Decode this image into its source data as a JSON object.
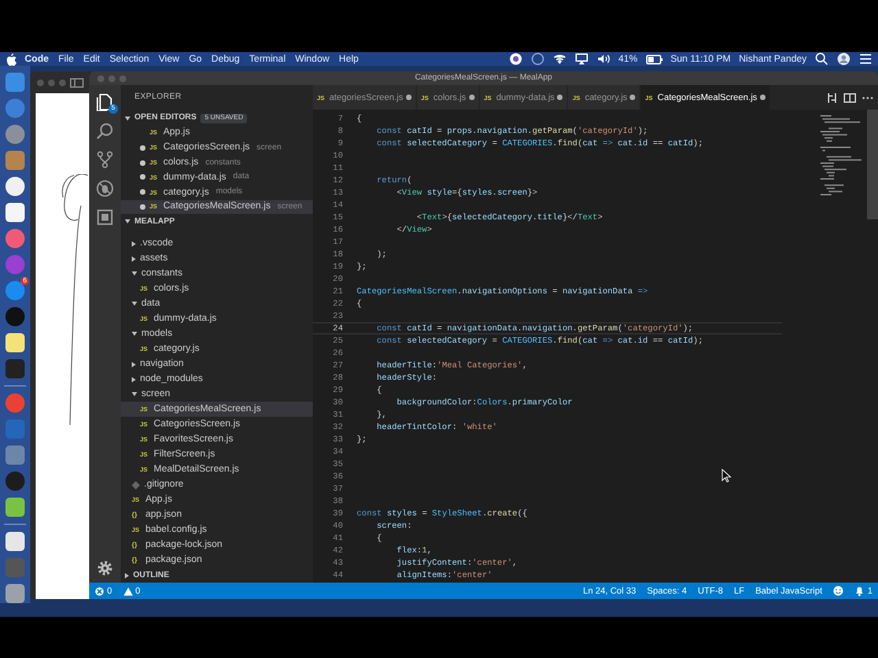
{
  "menu_bar": {
    "app": "Code",
    "menus": [
      "File",
      "Edit",
      "Selection",
      "View",
      "Go",
      "Debug",
      "Terminal",
      "Window",
      "Help"
    ],
    "battery": "41%",
    "clock": "Sun 11:10 PM",
    "user": "Nishant Pandey"
  },
  "dock": {
    "badge": "6"
  },
  "window": {
    "title": "CategoriesMealScreen.js — MealApp"
  },
  "activity_bar": {
    "badge": "5"
  },
  "sidebar": {
    "title": "EXPLORER",
    "open_editors": {
      "label": "OPEN EDITORS",
      "badge": "5 UNSAVED",
      "expanded": true,
      "items": [
        {
          "icon": "JS",
          "name": "App.js",
          "dirty": false,
          "selected": false
        },
        {
          "icon": "JS",
          "name": "CategoriesScreen.js",
          "detail": "screen",
          "dirty": true,
          "selected": false
        },
        {
          "icon": "JS",
          "name": "colors.js",
          "detail": "constants",
          "dirty": true,
          "selected": false
        },
        {
          "icon": "JS",
          "name": "dummy-data.js",
          "detail": "data",
          "dirty": true,
          "selected": false
        },
        {
          "icon": "JS",
          "name": "category.js",
          "detail": "models",
          "dirty": true,
          "selected": false
        },
        {
          "icon": "JS",
          "name": "CategoriesMealScreen.js",
          "detail": "screen",
          "dirty": true,
          "selected": true
        }
      ]
    },
    "project": {
      "label": "MEALAPP",
      "expanded": true,
      "items": [
        {
          "kind": "folder",
          "name": ".vscode",
          "expanded": false,
          "selected": false
        },
        {
          "kind": "folder",
          "name": "assets",
          "expanded": false,
          "selected": false
        },
        {
          "kind": "folder",
          "name": "constants",
          "expanded": true,
          "selected": false,
          "children": [
            {
              "kind": "js",
              "icon": "JS",
              "name": "colors.js",
              "selected": false
            }
          ]
        },
        {
          "kind": "folder",
          "name": "data",
          "expanded": true,
          "selected": false,
          "children": [
            {
              "kind": "js",
              "icon": "JS",
              "name": "dummy-data.js",
              "selected": false
            }
          ]
        },
        {
          "kind": "folder",
          "name": "models",
          "expanded": true,
          "selected": false,
          "children": [
            {
              "kind": "js",
              "icon": "JS",
              "name": "category.js",
              "selected": false
            }
          ]
        },
        {
          "kind": "folder",
          "name": "navigation",
          "expanded": false,
          "selected": false
        },
        {
          "kind": "folder",
          "name": "node_modules",
          "expanded": false,
          "selected": false
        },
        {
          "kind": "folder",
          "name": "screen",
          "expanded": true,
          "selected": false,
          "children": [
            {
              "kind": "js",
              "icon": "JS",
              "name": "CategoriesMealScreen.js",
              "selected": true
            },
            {
              "kind": "js",
              "icon": "JS",
              "name": "CategoriesScreen.js",
              "selected": false
            },
            {
              "kind": "js",
              "icon": "JS",
              "name": "FavoritesScreen.js",
              "selected": false
            },
            {
              "kind": "js",
              "icon": "JS",
              "name": "FilterScreen.js",
              "selected": false
            },
            {
              "kind": "js",
              "icon": "JS",
              "name": "MealDetailScreen.js",
              "selected": false
            }
          ]
        },
        {
          "kind": "gitignore",
          "name": ".gitignore",
          "selected": false
        },
        {
          "kind": "js",
          "icon": "JS",
          "name": "App.js",
          "selected": false
        },
        {
          "kind": "json",
          "icon": "{}",
          "name": "app.json",
          "selected": false
        },
        {
          "kind": "js",
          "icon": "JS",
          "name": "babel.config.js",
          "selected": false
        },
        {
          "kind": "json",
          "icon": "{}",
          "name": "package-lock.json",
          "selected": false
        },
        {
          "kind": "json",
          "icon": "{}",
          "name": "package.json",
          "selected": false
        }
      ]
    },
    "outline": {
      "label": "OUTLINE",
      "expanded": false
    }
  },
  "tabs": [
    {
      "icon": "JS",
      "label": "ategoriesScreen.js",
      "dirty": true,
      "selected": false
    },
    {
      "icon": "JS",
      "label": "colors.js",
      "dirty": true,
      "selected": false
    },
    {
      "icon": "JS",
      "label": "dummy-data.js",
      "dirty": true,
      "selected": false
    },
    {
      "icon": "JS",
      "label": "category.js",
      "dirty": true,
      "selected": false
    },
    {
      "icon": "JS",
      "label": "CategoriesMealScreen.js",
      "dirty": true,
      "selected": true
    }
  ],
  "editor": {
    "lines": [
      {
        "n": "7",
        "active": false,
        "tokens": [
          {
            "text": "{",
            "kind": "pun"
          }
        ]
      },
      {
        "n": "8",
        "active": false,
        "tokens": [
          {
            "text": "    const",
            "kind": "kw"
          },
          {
            "text": " catId",
            "kind": "var"
          },
          {
            "text": " = ",
            "kind": "pun"
          },
          {
            "text": "props.navigation.",
            "kind": "var"
          },
          {
            "text": "getParam",
            "kind": "fn"
          },
          {
            "text": "(",
            "kind": "pun"
          },
          {
            "text": "'categoryId'",
            "kind": "str"
          },
          {
            "text": ");",
            "kind": "pun"
          }
        ]
      },
      {
        "n": "9",
        "active": false,
        "tokens": [
          {
            "text": "    const",
            "kind": "kw"
          },
          {
            "text": " selectedCategory",
            "kind": "var"
          },
          {
            "text": " = ",
            "kind": "pun"
          },
          {
            "text": "CATEGORIES",
            "kind": "cls"
          },
          {
            "text": ".",
            "kind": "pun"
          },
          {
            "text": "find",
            "kind": "fn"
          },
          {
            "text": "(",
            "kind": "pun"
          },
          {
            "text": "cat",
            "kind": "var"
          },
          {
            "text": " =>",
            "kind": "kw"
          },
          {
            "text": " cat.id",
            "kind": "var"
          },
          {
            "text": " == ",
            "kind": "pun"
          },
          {
            "text": "catId",
            "kind": "var"
          },
          {
            "text": ");",
            "kind": "pun"
          }
        ]
      },
      {
        "n": "10",
        "active": false
      },
      {
        "n": "11",
        "active": false
      },
      {
        "n": "12",
        "active": false,
        "tokens": [
          {
            "text": "    return",
            "kind": "kw"
          },
          {
            "text": "(",
            "kind": "pun"
          }
        ]
      },
      {
        "n": "13",
        "active": false,
        "tokens": [
          {
            "text": "        <",
            "kind": "pun"
          },
          {
            "text": "View",
            "kind": "tag"
          },
          {
            "text": " style",
            "kind": "var"
          },
          {
            "text": "={",
            "kind": "pun"
          },
          {
            "text": "styles.screen",
            "kind": "var"
          },
          {
            "text": "}>",
            "kind": "pun"
          }
        ]
      },
      {
        "n": "14",
        "active": false
      },
      {
        "n": "15",
        "active": false,
        "tokens": [
          {
            "text": "            <",
            "kind": "pun"
          },
          {
            "text": "Text",
            "kind": "tag"
          },
          {
            "text": ">{",
            "kind": "pun"
          },
          {
            "text": "selectedCategory.title",
            "kind": "var"
          },
          {
            "text": "}</",
            "kind": "pun"
          },
          {
            "text": "Text",
            "kind": "tag"
          },
          {
            "text": ">",
            "kind": "pun"
          }
        ]
      },
      {
        "n": "16",
        "active": false,
        "tokens": [
          {
            "text": "        </",
            "kind": "pun"
          },
          {
            "text": "View",
            "kind": "tag"
          },
          {
            "text": ">",
            "kind": "pun"
          }
        ]
      },
      {
        "n": "17",
        "active": false
      },
      {
        "n": "18",
        "active": false,
        "tokens": [
          {
            "text": "    );",
            "kind": "pun"
          }
        ]
      },
      {
        "n": "19",
        "active": false,
        "tokens": [
          {
            "text": "};",
            "kind": "pun"
          }
        ]
      },
      {
        "n": "20",
        "active": false
      },
      {
        "n": "21",
        "active": false,
        "tokens": [
          {
            "text": "CategoriesMealScreen",
            "kind": "cls"
          },
          {
            "text": ".",
            "kind": "pun"
          },
          {
            "text": "navigationOptions",
            "kind": "var"
          },
          {
            "text": " = ",
            "kind": "pun"
          },
          {
            "text": "navigationData",
            "kind": "var"
          },
          {
            "text": " =>",
            "kind": "kw"
          }
        ]
      },
      {
        "n": "22",
        "active": false,
        "tokens": [
          {
            "text": "{",
            "kind": "pun"
          }
        ]
      },
      {
        "n": "23",
        "active": false
      },
      {
        "n": "24",
        "active": true,
        "tokens": [
          {
            "text": "    const",
            "kind": "kw"
          },
          {
            "text": " catId",
            "kind": "var"
          },
          {
            "text": " = ",
            "kind": "pun"
          },
          {
            "text": "navigationData.navigation.",
            "kind": "var"
          },
          {
            "text": "getParam",
            "kind": "fn"
          },
          {
            "text": "(",
            "kind": "pun"
          },
          {
            "text": "'categoryId'",
            "kind": "str"
          },
          {
            "text": ");",
            "kind": "pun"
          }
        ]
      },
      {
        "n": "25",
        "active": false,
        "tokens": [
          {
            "text": "    const",
            "kind": "kw"
          },
          {
            "text": " selectedCategory",
            "kind": "var"
          },
          {
            "text": " = ",
            "kind": "pun"
          },
          {
            "text": "CATEGORIES",
            "kind": "cls"
          },
          {
            "text": ".",
            "kind": "pun"
          },
          {
            "text": "find",
            "kind": "fn"
          },
          {
            "text": "(",
            "kind": "pun"
          },
          {
            "text": "cat",
            "kind": "var"
          },
          {
            "text": " =>",
            "kind": "kw"
          },
          {
            "text": " cat.id",
            "kind": "var"
          },
          {
            "text": " == ",
            "kind": "pun"
          },
          {
            "text": "catId",
            "kind": "var"
          },
          {
            "text": ");",
            "kind": "pun"
          }
        ]
      },
      {
        "n": "26",
        "active": false
      },
      {
        "n": "27",
        "active": false,
        "tokens": [
          {
            "text": "    headerTitle",
            "kind": "var"
          },
          {
            "text": ":",
            "kind": "pun"
          },
          {
            "text": "'Meal Categories'",
            "kind": "str"
          },
          {
            "text": ",",
            "kind": "pun"
          }
        ]
      },
      {
        "n": "28",
        "active": false,
        "tokens": [
          {
            "text": "    headerStyle",
            "kind": "var"
          },
          {
            "text": ":",
            "kind": "pun"
          }
        ]
      },
      {
        "n": "29",
        "active": false,
        "tokens": [
          {
            "text": "    {",
            "kind": "pun"
          }
        ]
      },
      {
        "n": "30",
        "active": false,
        "tokens": [
          {
            "text": "        backgroundColor",
            "kind": "var"
          },
          {
            "text": ":",
            "kind": "pun"
          },
          {
            "text": "Colors",
            "kind": "cls"
          },
          {
            "text": ".",
            "kind": "pun"
          },
          {
            "text": "primaryColor",
            "kind": "var"
          }
        ]
      },
      {
        "n": "31",
        "active": false,
        "tokens": [
          {
            "text": "    },",
            "kind": "pun"
          }
        ]
      },
      {
        "n": "32",
        "active": false,
        "tokens": [
          {
            "text": "    headerTintColor",
            "kind": "var"
          },
          {
            "text": ": ",
            "kind": "pun"
          },
          {
            "text": "'white'",
            "kind": "str"
          }
        ]
      },
      {
        "n": "33",
        "active": false,
        "tokens": [
          {
            "text": "};",
            "kind": "pun"
          }
        ]
      },
      {
        "n": "34",
        "active": false
      },
      {
        "n": "35",
        "active": false
      },
      {
        "n": "36",
        "active": false
      },
      {
        "n": "37",
        "active": false
      },
      {
        "n": "38",
        "active": false
      },
      {
        "n": "39",
        "active": false,
        "tokens": [
          {
            "text": "const",
            "kind": "kw"
          },
          {
            "text": " styles",
            "kind": "var"
          },
          {
            "text": " = ",
            "kind": "pun"
          },
          {
            "text": "StyleSheet",
            "kind": "cls"
          },
          {
            "text": ".",
            "kind": "pun"
          },
          {
            "text": "create",
            "kind": "fn"
          },
          {
            "text": "({",
            "kind": "pun"
          }
        ]
      },
      {
        "n": "40",
        "active": false,
        "tokens": [
          {
            "text": "    screen",
            "kind": "var"
          },
          {
            "text": ":",
            "kind": "pun"
          }
        ]
      },
      {
        "n": "41",
        "active": false,
        "tokens": [
          {
            "text": "    {",
            "kind": "pun"
          }
        ]
      },
      {
        "n": "42",
        "active": false,
        "tokens": [
          {
            "text": "        flex",
            "kind": "var"
          },
          {
            "text": ":",
            "kind": "pun"
          },
          {
            "text": "1",
            "kind": "num"
          },
          {
            "text": ",",
            "kind": "pun"
          }
        ]
      },
      {
        "n": "43",
        "active": false,
        "tokens": [
          {
            "text": "        justifyContent",
            "kind": "var"
          },
          {
            "text": ":",
            "kind": "pun"
          },
          {
            "text": "'center'",
            "kind": "str"
          },
          {
            "text": ",",
            "kind": "pun"
          }
        ]
      },
      {
        "n": "44",
        "active": false,
        "tokens": [
          {
            "text": "        alignItems",
            "kind": "var"
          },
          {
            "text": ":",
            "kind": "pun"
          },
          {
            "text": "'center'",
            "kind": "str"
          }
        ]
      }
    ]
  },
  "status_bar": {
    "errors": "0",
    "warnings": "0",
    "position": "Ln 24, Col 33",
    "indent": "Spaces: 4",
    "encoding": "UTF-8",
    "eol": "LF",
    "language": "Babel JavaScript",
    "notifications": "1"
  }
}
